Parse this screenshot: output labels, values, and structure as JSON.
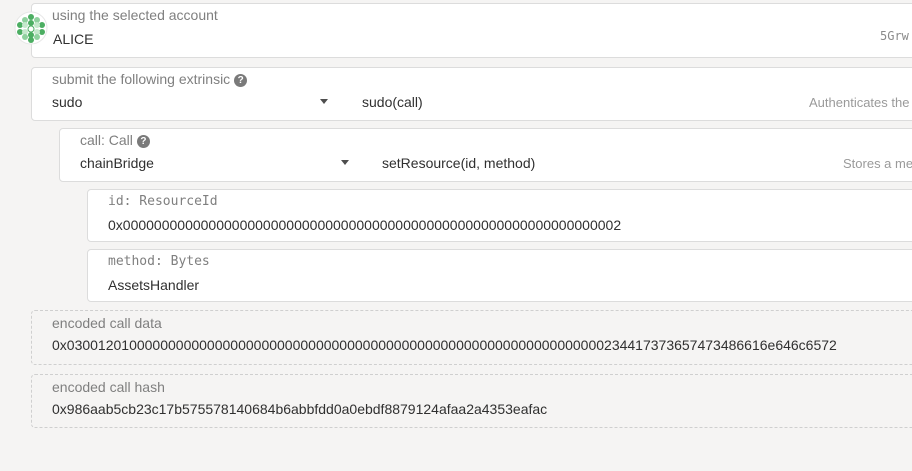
{
  "account": {
    "label": "using the selected account",
    "name": "ALICE",
    "address_fragment": "5Grw"
  },
  "extrinsic": {
    "label": "submit the following extrinsic",
    "section": "sudo",
    "method": "sudo(call)",
    "description": "Authenticates the"
  },
  "call": {
    "label": "call: Call",
    "section": "chainBridge",
    "method": "setResource(id, method)",
    "description": "Stores a me"
  },
  "params": {
    "id_label": "id: ResourceId",
    "id_value": "0x0000000000000000000000000000000000000000000000000000000000000002",
    "method_label": "method: Bytes",
    "method_value": "AssetsHandler"
  },
  "encoded": {
    "data_label": "encoded call data",
    "data_value": "0x030012010000000000000000000000000000000000000000000000000000000000000234417373657473486616e646c6572",
    "hash_label": "encoded call hash",
    "hash_value": "0x986aab5cb23c17b575578140684b6abbfdd0a0ebdf8879124afaa2a4353eafac"
  },
  "colors": {
    "background": "#f5f4f3",
    "identicon_green": "#4cae62"
  },
  "icons": {
    "account": "identicon",
    "help": "question-circle-icon",
    "dropdown": "caret-down-icon"
  }
}
